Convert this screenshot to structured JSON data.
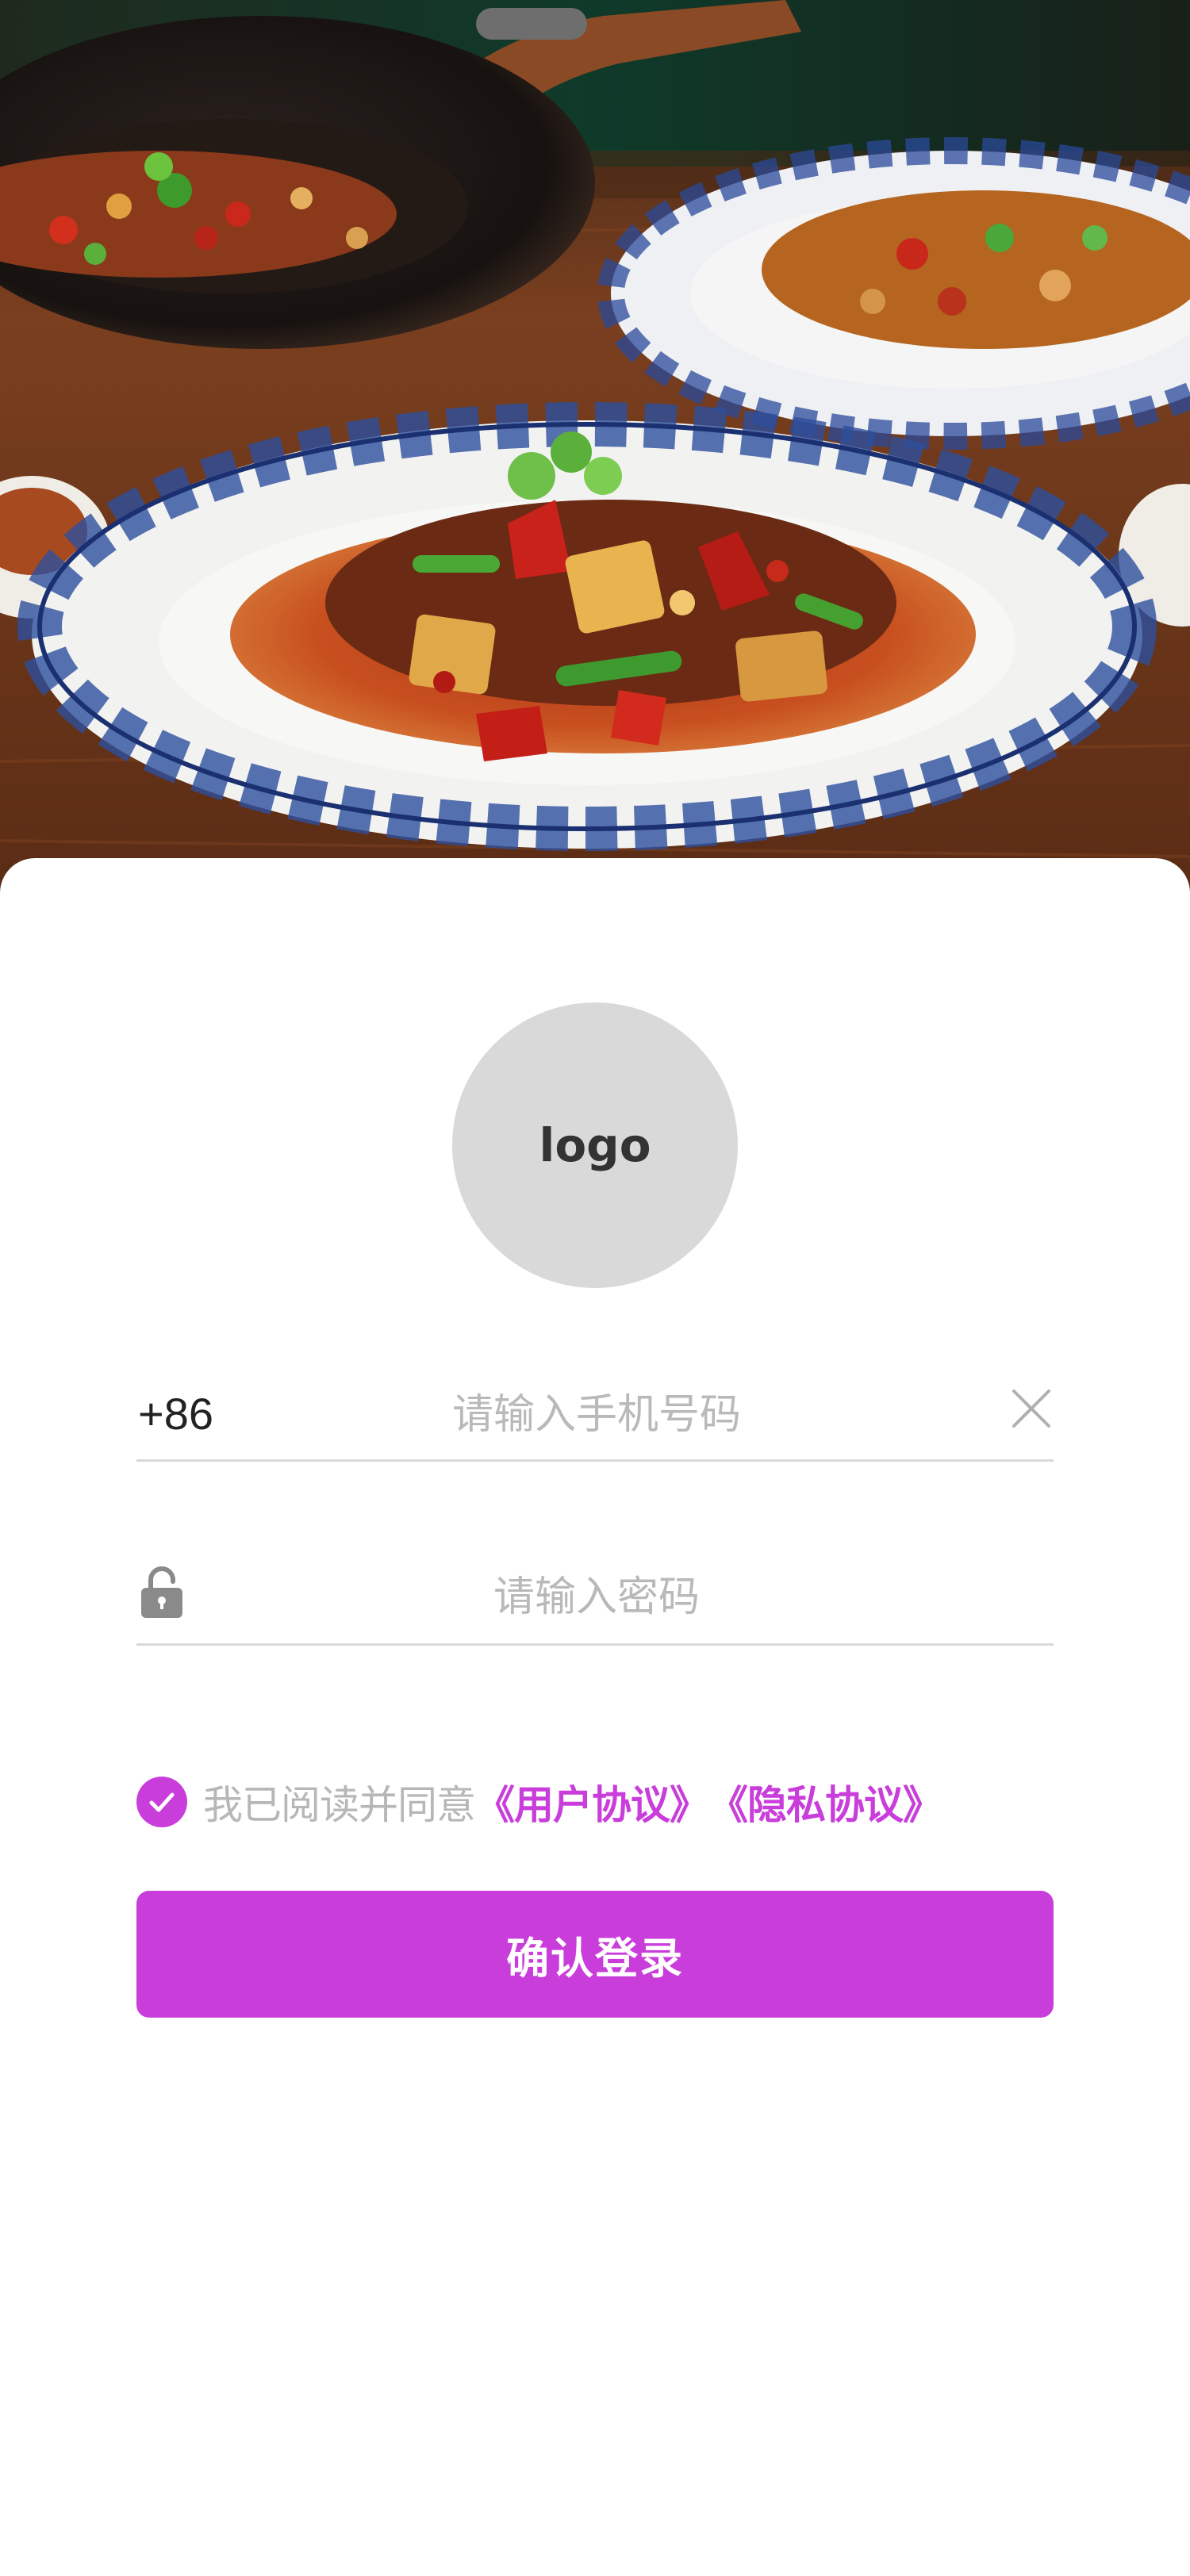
{
  "hero": {
    "image_icon": "sichuan-stir-fry-dishes-photo"
  },
  "logo": {
    "text": "logo"
  },
  "phone": {
    "prefix": "+86",
    "placeholder": "请输入手机号码",
    "value": "",
    "clear_icon": "close-icon"
  },
  "password": {
    "placeholder": "请输入密码",
    "value": "",
    "lock_icon": "unlock-icon"
  },
  "agreement": {
    "checked": true,
    "text": "我已阅读并同意",
    "user_agreement": "《用户协议》",
    "privacy_agreement": "《隐私协议》"
  },
  "login": {
    "label": "确认登录"
  },
  "colors": {
    "accent": "#c93edb",
    "placeholder": "#b9b9b9",
    "divider": "#d8d8d8",
    "logo_bg": "#d9d9d9"
  }
}
